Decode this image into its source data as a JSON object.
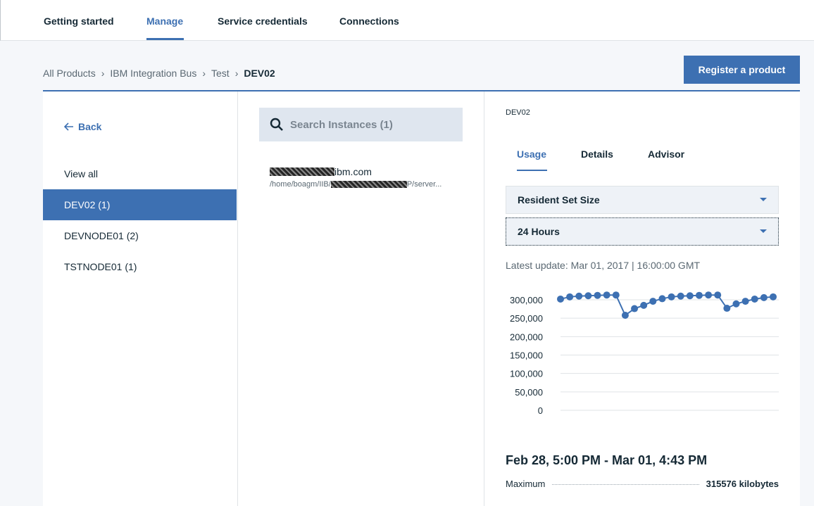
{
  "topnav": {
    "tabs": [
      {
        "label": "Getting started"
      },
      {
        "label": "Manage"
      },
      {
        "label": "Service credentials"
      },
      {
        "label": "Connections"
      }
    ],
    "active": "Manage"
  },
  "breadcrumb": [
    "All Products",
    "IBM Integration Bus",
    "Test",
    "DEV02"
  ],
  "register_label": "Register a product",
  "sidebar": {
    "back_label": "Back",
    "items": [
      {
        "label": "View all"
      },
      {
        "label": "DEV02 (1)"
      },
      {
        "label": "DEVNODE01 (2)"
      },
      {
        "label": "TSTNODE01 (1)"
      }
    ],
    "selected": "DEV02 (1)"
  },
  "search": {
    "placeholder": "Search Instances (1)"
  },
  "instance": {
    "host_suffix": "ibm.com",
    "path_prefix": "/home/boagm/IIB/",
    "path_suffix": "P/server..."
  },
  "detail": {
    "title": "DEV02",
    "tabs": [
      {
        "label": "Usage"
      },
      {
        "label": "Details"
      },
      {
        "label": "Advisor"
      }
    ],
    "active_tab": "Usage",
    "metric_select": "Resident Set Size",
    "period_select": "24 Hours",
    "latest_update": "Latest update: Mar 01, 2017 | 16:00:00 GMT",
    "range": "Feb 28, 5:00 PM - Mar 01, 4:43 PM",
    "stat_label": "Maximum",
    "stat_value": "315576 kilobytes"
  },
  "colors": {
    "accent": "#3d70b2",
    "text": "#152935"
  },
  "chart_data": {
    "type": "line",
    "y_tick_labels": [
      "300,000",
      "250,000",
      "200,000",
      "150,000",
      "100,000",
      "50,000",
      "0"
    ],
    "y_ticks": [
      300000,
      250000,
      200000,
      150000,
      100000,
      50000,
      0
    ],
    "ylim": [
      0,
      300000
    ],
    "grid": true,
    "series": [
      {
        "values": [
          302000,
          308000,
          310000,
          311000,
          312000,
          313000,
          313000,
          258000,
          276000,
          285000,
          296000,
          303000,
          308000,
          310000,
          311000,
          312000,
          313000,
          313000,
          277000,
          289000,
          296000,
          302000,
          306000,
          308000
        ]
      }
    ]
  }
}
